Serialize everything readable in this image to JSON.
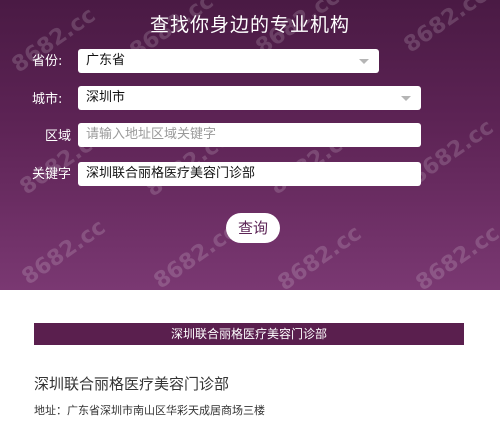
{
  "header": {
    "title": "查找你身边的专业机构"
  },
  "form": {
    "province_label": "省份:",
    "province_value": "广东省",
    "city_label": "城市:",
    "city_value": "深圳市",
    "area_label": "区域",
    "area_placeholder": "请输入地址区域关键字",
    "keyword_label": "关键字",
    "keyword_value": "深圳联合丽格医疗美容门诊部",
    "submit_label": "查询"
  },
  "watermark": {
    "text": "8682.cc"
  },
  "result": {
    "banner": "深圳联合丽格医疗美容门诊部",
    "name": "深圳联合丽格医疗美容门诊部",
    "address": "地址：广东省深圳市南山区华彩天成居商场三楼"
  },
  "colors": {
    "hero_top": "#4a1a44",
    "hero_bottom": "#7a3872",
    "banner": "#5a1f4e"
  }
}
